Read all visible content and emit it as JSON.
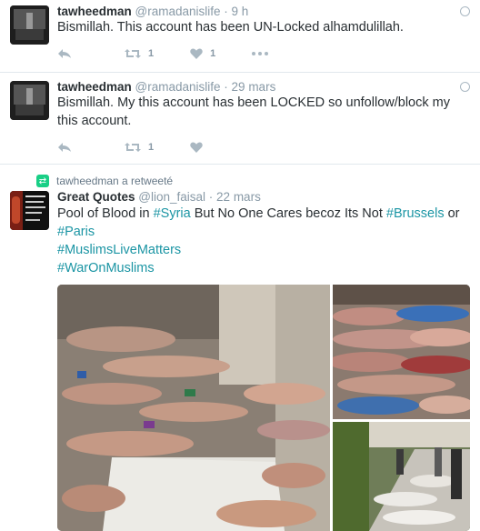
{
  "tweets": [
    {
      "name": "tawheedman",
      "handle": "@ramadanislife",
      "time": "9 h",
      "text": "Bismillah. This account has been UN-Locked alhamdulillah.",
      "retweets": "1",
      "likes": "1",
      "icons": [
        "reply-icon",
        "retweet-icon",
        "heart-icon",
        "more-icon"
      ]
    },
    {
      "name": "tawheedman",
      "handle": "@ramadanislife",
      "time": "29 mars",
      "text": "Bismillah. My this account has been LOCKED so unfollow/block my this account.",
      "retweets": "1",
      "icons": [
        "reply-icon",
        "retweet-icon",
        "heart-icon"
      ]
    }
  ],
  "retweet": {
    "context": "tawheedman a retweeté",
    "name": "Great Quotes",
    "handle": "@lion_faisal",
    "time": "22 mars",
    "text_plain": "Pool of Blood in ",
    "tag_syria": "#Syria",
    "text_mid": " But No One Cares becoz Its Not ",
    "tag_brussels": "#Brussels",
    "text_or": " or",
    "tag_paris": "#Paris",
    "tag_muslims": "#MuslimsLiveMatters",
    "tag_war": "#WarOnMuslims"
  },
  "separator": " · ",
  "colors": {
    "hashtag": "#1b95a4",
    "muted": "#8899a6",
    "retweet_badge": "#19cf86"
  }
}
